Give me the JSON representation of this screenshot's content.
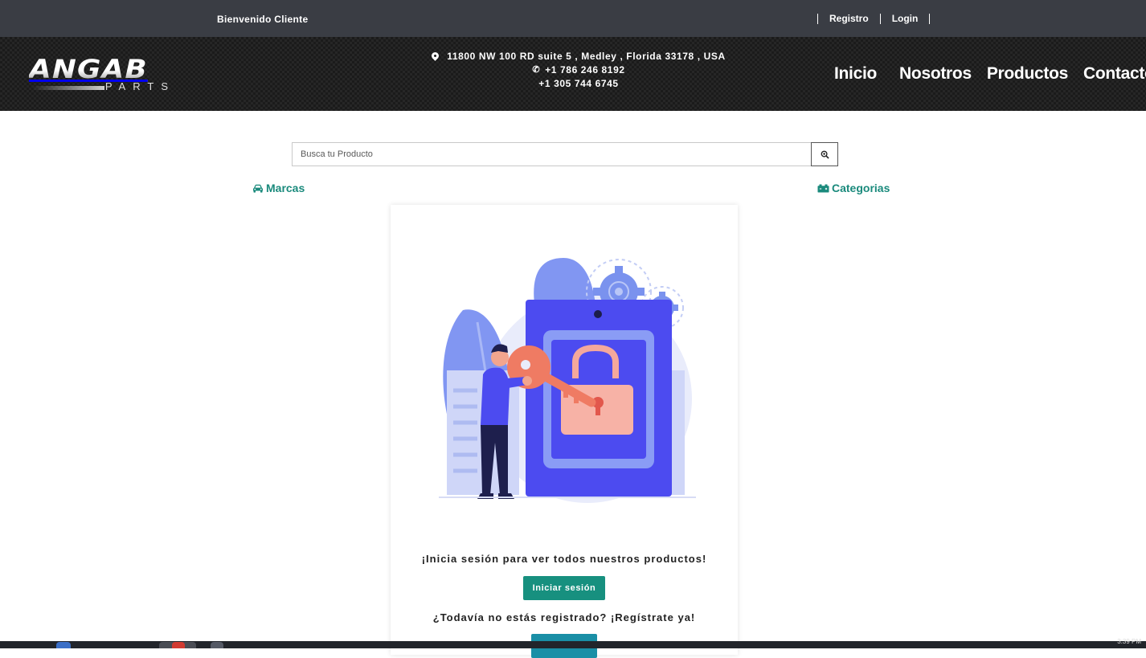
{
  "topbar": {
    "welcome": "Bienvenido  Cliente",
    "register_link": "Registro",
    "login_link": "Login"
  },
  "header": {
    "logo_main": "ANGAB",
    "logo_sub": "PARTS",
    "address": "11800  NW  100  RD  suite  5  ,  Medley  ,  Florida  33178  ,  USA",
    "phone1": "+1  786  246  8192",
    "phone2": "+1  305  744  6745",
    "icons": {
      "address": "map-pin-icon",
      "phone": "phone-icon"
    },
    "nav": [
      "Inicio",
      "Nosotros",
      "Productos",
      "Contacto"
    ]
  },
  "search": {
    "placeholder": "Busca tu Producto",
    "button_icon": "zoom-search-icon"
  },
  "links": {
    "brands": "Marcas",
    "brands_icon": "car-icon",
    "categories": "Categorias",
    "categories_icon": "battery-icon"
  },
  "card": {
    "illustration": "person-key-padlock-illustration",
    "message_login": "¡Inicia sesión para ver todos nuestros productos!",
    "login_button": "Iniciar sesión",
    "message_register": "¿Todavía no estás registrado? ¡Regístrate ya!"
  },
  "taskbar": {
    "clock": "3:39 PM"
  },
  "colors": {
    "accent_teal": "#17907f",
    "link_teal": "#1a8a7c",
    "topbar_bg": "#3a3d44",
    "header_bg": "#1b1b1b",
    "illustration_blue": "#4c4bf0"
  }
}
